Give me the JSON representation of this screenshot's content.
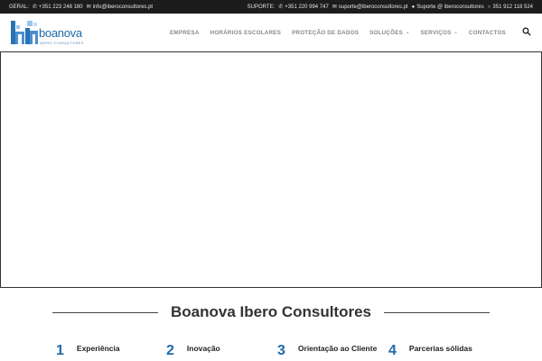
{
  "topbar": {
    "geral_label": "GERAL:",
    "geral_phone": "+351 223 248 180",
    "geral_email": "info@iberoconsultores.pt",
    "suporte_label": "SUPORTE:",
    "suporte_phone": "+351 220 994 747",
    "suporte_email": "suporte@iberoconsultores.pt",
    "skype": "Suporte @ iberoconsultores",
    "whatsapp": "351 912 118 524"
  },
  "logo": {
    "word": "boanova",
    "sub": "IBERO CONSULTORES"
  },
  "nav": {
    "items": [
      {
        "label": "EMPRESA"
      },
      {
        "label": "HORÁRIOS ESCOLARES"
      },
      {
        "label": "PROTEÇÃO DE DADOS"
      },
      {
        "label": "SOLUÇÕES"
      },
      {
        "label": "SERVIÇOS"
      },
      {
        "label": "CONTACTOS"
      }
    ]
  },
  "section": {
    "title": "Boanova Ibero Consultores"
  },
  "features": [
    {
      "num": "1",
      "label": "Experiência"
    },
    {
      "num": "2",
      "label": "Inovação"
    },
    {
      "num": "3",
      "label": "Orientação ao Cliente"
    },
    {
      "num": "4",
      "label": "Parcerias sólidas"
    }
  ],
  "colors": {
    "brand": "#1e6aa8",
    "topbar_bg": "#1c1c1c",
    "nav_text": "#8a8a8a"
  },
  "icons": {
    "phone": "phone-icon",
    "email": "envelope-icon",
    "skype": "skype-icon",
    "whatsapp": "whatsapp-icon",
    "search": "search-icon",
    "chevron": "chevron-down-icon"
  }
}
